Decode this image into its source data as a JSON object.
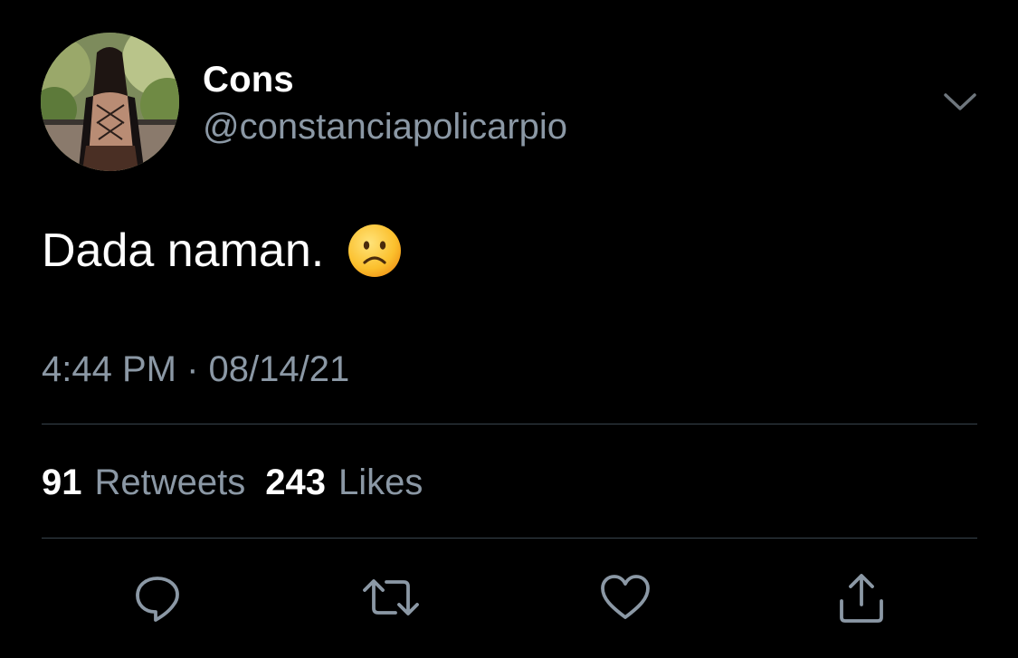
{
  "user": {
    "display_name": "Cons",
    "handle": "@constanciapolicarpio",
    "avatar_icon": "profile-photo"
  },
  "tweet": {
    "text": "Dada naman.",
    "emoji": "frowning-face-emoji",
    "timestamp": "4:44 PM · 08/14/21"
  },
  "stats": {
    "retweets_count": "91",
    "retweets_label": "Retweets",
    "likes_count": "243",
    "likes_label": "Likes"
  },
  "actions": {
    "reply_icon": "reply-icon",
    "retweet_icon": "retweet-icon",
    "like_icon": "heart-icon",
    "share_icon": "share-icon",
    "menu_icon": "chevron-down-icon"
  },
  "colors": {
    "background": "#000000",
    "primary_text": "#ffffff",
    "secondary_text": "#8b98a5",
    "divider": "#38444d"
  }
}
